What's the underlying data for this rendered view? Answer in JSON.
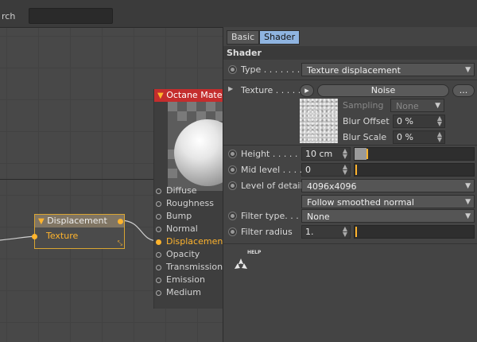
{
  "topbar": {
    "search_label": "rch"
  },
  "node_editor": {
    "displacement_node": {
      "title": "Displacement",
      "port": "Texture"
    },
    "material_node": {
      "title": "Octane Material",
      "inputs": [
        "Diffuse",
        "Roughness",
        "Bump",
        "Normal",
        "Displacement",
        "Opacity",
        "Transmission",
        "Emission",
        "Medium"
      ],
      "active_input": "Displacement"
    }
  },
  "panel": {
    "tabs": [
      {
        "label": "Basic"
      },
      {
        "label": "Shader",
        "active": true
      }
    ],
    "section_title": "Shader",
    "type": {
      "label": "Type . . . . . . . . .",
      "value": "Texture displacement"
    },
    "texture": {
      "label": "Texture . . . . . .",
      "value": "Noise",
      "more": "..."
    },
    "sampling": {
      "label": "Sampling",
      "value": "None"
    },
    "blur_offset": {
      "label": "Blur Offset",
      "value": "0 %"
    },
    "blur_scale": {
      "label": "Blur Scale",
      "value": "0 %"
    },
    "height": {
      "label": "Height . . . . . . .",
      "value": "10 cm",
      "fraction": 0.1
    },
    "mid_level": {
      "label": "Mid level  . . . .",
      "value": "0",
      "fraction": 0
    },
    "level_of_detail": {
      "label": "Level of detail",
      "value": "4096x4096"
    },
    "smoothing": {
      "value": "Follow smoothed normal"
    },
    "filter_type": {
      "label": "Filter type. . . .",
      "value": "None"
    },
    "filter_radius": {
      "label": "Filter radius",
      "value": "1.",
      "fraction": 0
    },
    "help_label": "HELP"
  },
  "colors": {
    "accent": "#ffb42d",
    "material_header": "#c42d2d",
    "tab_active": "#8fb4e0"
  }
}
